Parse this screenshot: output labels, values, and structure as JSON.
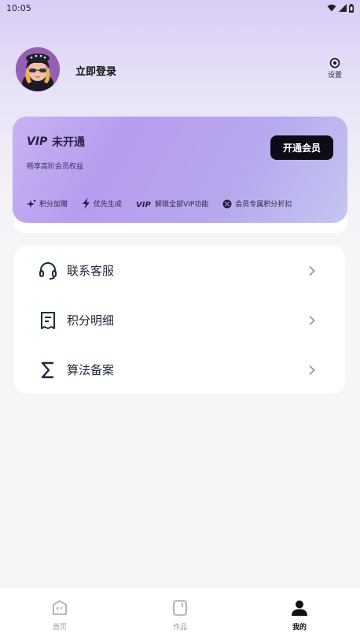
{
  "status_bar": {
    "time": "10:05"
  },
  "profile": {
    "login_label": "立即登录"
  },
  "settings": {
    "label": "设置"
  },
  "vip": {
    "logo_text": "VIP",
    "status": "未开通",
    "description": "畅享高阶会员权益",
    "open_button": "开通会员",
    "perks": [
      {
        "icon": "sparkle-icon",
        "label": "积分加赠"
      },
      {
        "icon": "lightning-icon",
        "label": "优先生成"
      },
      {
        "icon": "vip-icon",
        "label": "解锁全部VIP功能"
      },
      {
        "icon": "discount-icon",
        "label": "会员专属积分折扣"
      }
    ]
  },
  "menu": [
    {
      "icon": "headset-icon",
      "label": "联系客服"
    },
    {
      "icon": "receipt-icon",
      "label": "积分明细"
    },
    {
      "icon": "sigma-icon",
      "label": "算法备案"
    }
  ],
  "tabs": [
    {
      "icon": "home-icon",
      "label": "首页",
      "active": false
    },
    {
      "icon": "works-icon",
      "label": "作品",
      "active": false
    },
    {
      "icon": "profile-icon",
      "label": "我的",
      "active": true
    }
  ],
  "colors": {
    "accent_purple": "#b89cef",
    "button_dark": "#0e0b16",
    "menu_icon": "#1d2a3a"
  }
}
